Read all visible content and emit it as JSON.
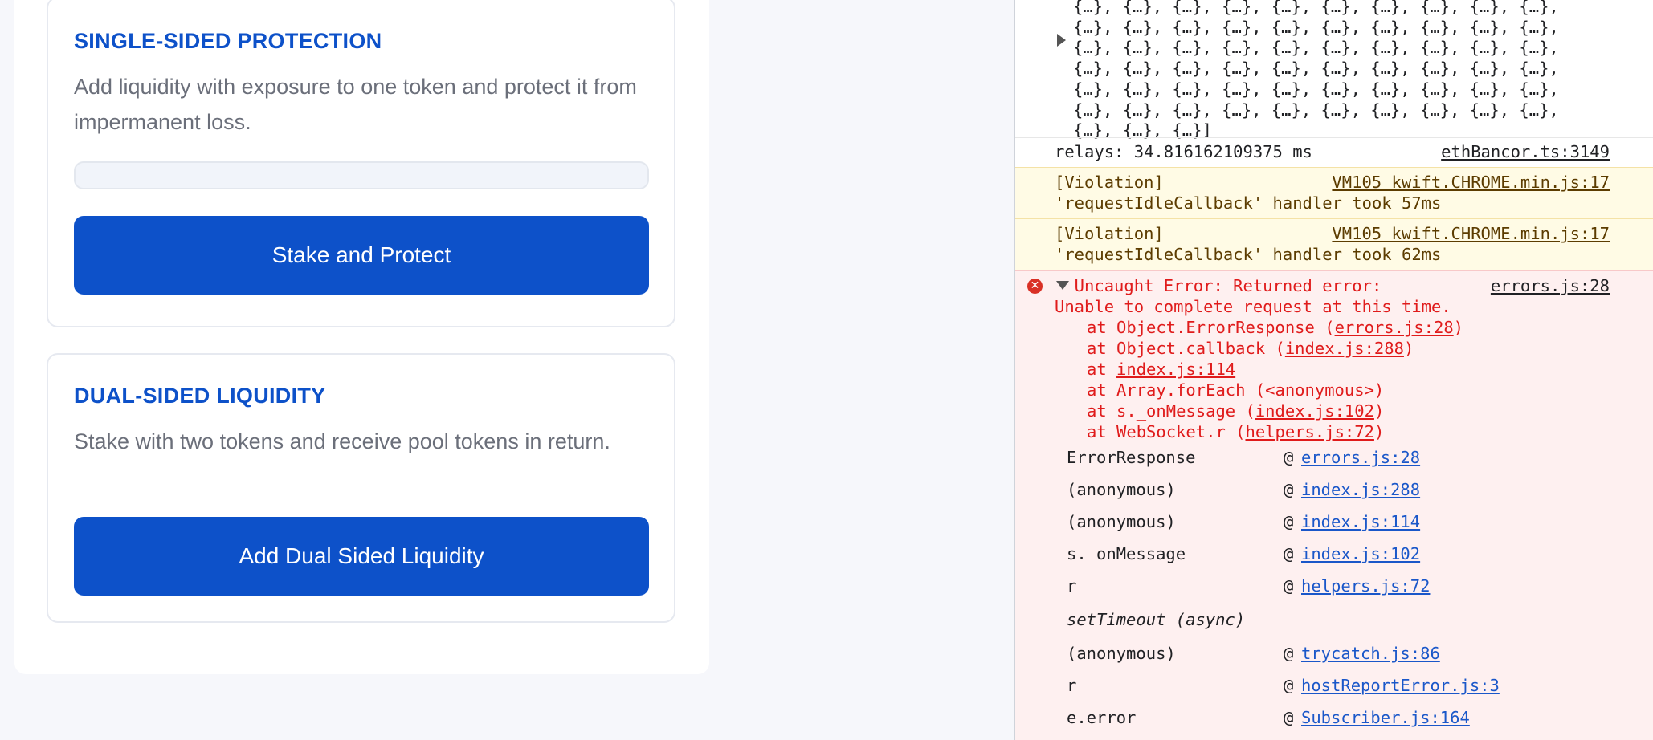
{
  "cards": [
    {
      "title": "SINGLE-SIDED PROTECTION",
      "description": "Add liquidity with exposure to one token and protect it from impermanent loss.",
      "button_label": "Stake and Protect",
      "progress": 0
    },
    {
      "title": "DUAL-SIDED LIQUIDITY",
      "description": "Stake with two tokens and receive pool tokens in return.",
      "button_label": "Add Dual Sided Liquidity"
    }
  ],
  "console": {
    "object_lines": [
      "{…}, {…}, {…}, {…}, {…}, {…}, {…}, {…}, {…}, {…},",
      "{…}, {…}, {…}, {…}, {…}, {…}, {…}, {…}, {…}, {…},",
      "{…}, {…}, {…}, {…}, {…}, {…}, {…}, {…}, {…}, {…},",
      "{…}, {…}, {…}, {…}, {…}, {…}, {…}, {…}, {…}, {…},",
      "{…}, {…}, {…}, {…}, {…}, {…}, {…}, {…}, {…}, {…},",
      "{…}, {…}, {…}, {…}, {…}, {…}, {…}, {…}, {…}, {…},",
      "{…}, {…}, {…}]"
    ],
    "log": {
      "message": "relays: 34.816162109375 ms",
      "source": "ethBancor.ts:3149"
    },
    "warnings": [
      {
        "message": "[Violation]\n'requestIdleCallback' handler took 57ms",
        "source": "VM105 kwift.CHROME.min.js:17"
      },
      {
        "message": "[Violation]\n'requestIdleCallback' handler took 62ms",
        "source": "VM105 kwift.CHROME.min.js:17"
      }
    ],
    "error": {
      "line1": "Uncaught Error: Returned error:",
      "line2": "Unable to complete request at this time.",
      "source": "errors.js:28",
      "stack": [
        {
          "prefix": "at Object.ErrorResponse (",
          "link": "errors.js:28",
          "suffix": ")"
        },
        {
          "prefix": "at Object.callback (",
          "link": "index.js:288",
          "suffix": ")"
        },
        {
          "prefix": "at ",
          "link": "index.js:114",
          "suffix": ""
        },
        {
          "prefix": "at Array.forEach (<anonymous>)",
          "link": "",
          "suffix": ""
        },
        {
          "prefix": "at s._onMessage (",
          "link": "index.js:102",
          "suffix": ")"
        },
        {
          "prefix": "at WebSocket.r (",
          "link": "helpers.js:72",
          "suffix": ")"
        }
      ],
      "trace": [
        {
          "fn": "ErrorResponse",
          "at": "@",
          "link": "errors.js:28"
        },
        {
          "fn": "(anonymous)",
          "at": "@",
          "link": "index.js:288"
        },
        {
          "fn": "(anonymous)",
          "at": "@",
          "link": "index.js:114"
        },
        {
          "fn": "s._onMessage",
          "at": "@",
          "link": "index.js:102"
        },
        {
          "fn": "r",
          "at": "@",
          "link": "helpers.js:72"
        }
      ],
      "async_label": "setTimeout (async)",
      "trace_async": [
        {
          "fn": "(anonymous)",
          "at": "@",
          "link": "trycatch.js:86"
        },
        {
          "fn": "r",
          "at": "@",
          "link": "hostReportError.js:3"
        },
        {
          "fn": "e.error",
          "at": "@",
          "link": "Subscriber.js:164"
        }
      ]
    }
  }
}
